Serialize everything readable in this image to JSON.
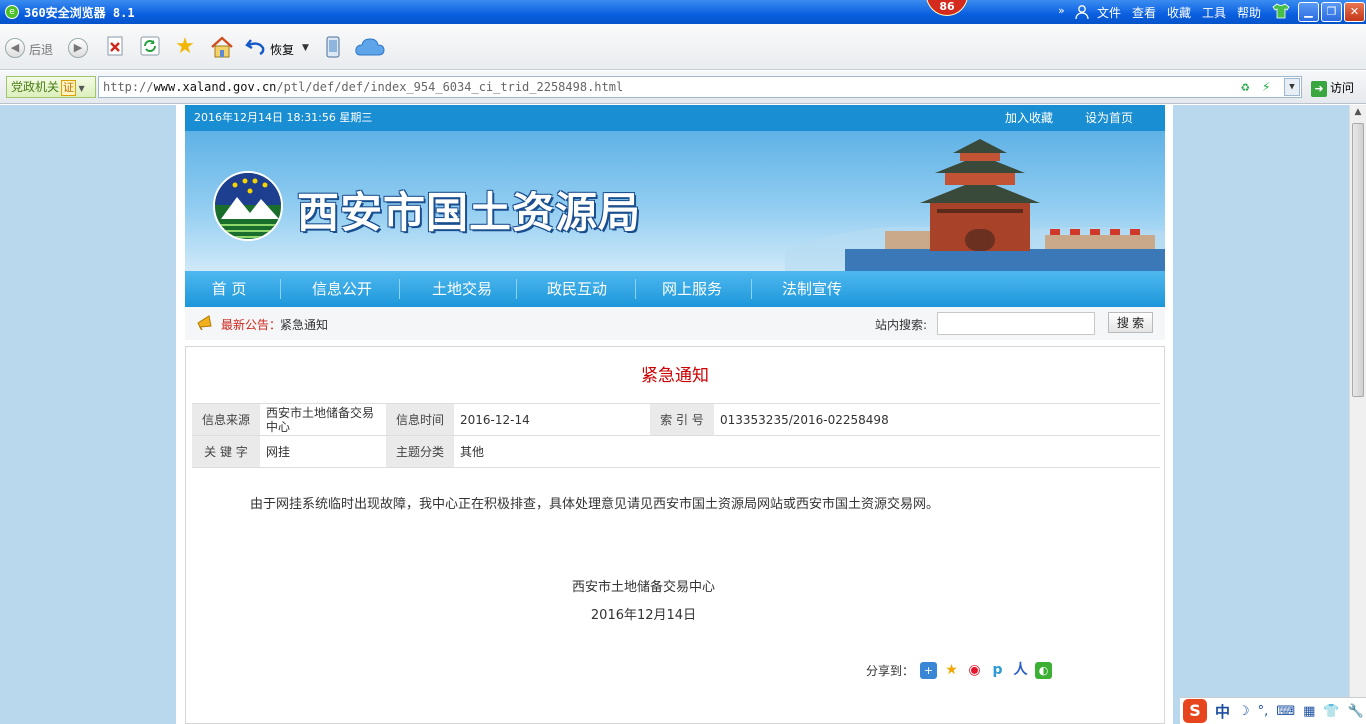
{
  "browser": {
    "title": "360安全浏览器 8.1",
    "badge_count": "86",
    "menu": [
      "文件",
      "查看",
      "收藏",
      "工具",
      "帮助"
    ],
    "toolbar": {
      "back": "后退",
      "restore": "恢复"
    },
    "address": {
      "gov_tag": "党政机关",
      "cert": "证",
      "url_scheme": "http://",
      "url_host": "www.xaland.gov.cn",
      "url_path": "/ptl/def/def/index_954_6034_ci_trid_2258498.html",
      "visit": "访问"
    }
  },
  "site": {
    "datetime": "2016年12月14日 18:31:56 星期三",
    "add_favorite": "加入收藏",
    "set_home": "设为首页",
    "logo_text": "西安市国土资源局",
    "nav": [
      "首 页",
      "信息公开",
      "土地交易",
      "政民互动",
      "网上服务",
      "法制宣传"
    ],
    "notice_label": "最新公告：",
    "notice_text": "紧急通知",
    "search_label": "站内搜索:",
    "search_value": "",
    "search_button": "搜 索"
  },
  "article": {
    "title": "紧急通知",
    "meta": {
      "source_label": "信息来源",
      "source_value": "西安市土地储备交易中心",
      "time_label": "信息时间",
      "time_value": "2016-12-14",
      "index_label": "索 引 号",
      "index_value": "013353235/2016-02258498",
      "keyword_label": "关 键 字",
      "keyword_value": "网挂",
      "topic_label": "主题分类",
      "topic_value": "其他"
    },
    "body": "由于网挂系统临时出现故障，我中心正在积极排查，具体处理意见请见西安市国土资源局网站或西安市国土资源交易网。",
    "sign_org": "西安市土地储备交易中心",
    "sign_date": "2016年12月14日",
    "share_label": "分享到："
  },
  "ime": {
    "mode": "中"
  },
  "colors": {
    "titlebar": "#0a5fe0",
    "site_blue": "#1a8ed3",
    "nav_blue": "#1c97da",
    "title_red": "#cc0000",
    "page_bg": "#b9d8ee"
  }
}
